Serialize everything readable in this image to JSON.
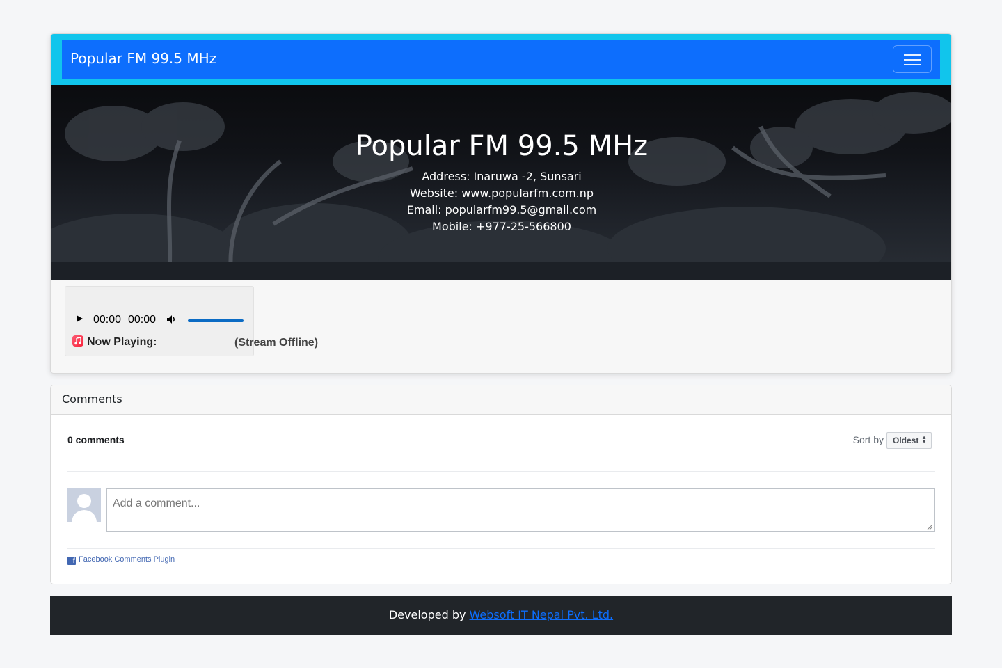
{
  "navbar": {
    "brand": "Popular FM 99.5 MHz",
    "toggler_icon": "hamburger-icon"
  },
  "hero": {
    "title": "Popular FM 99.5 MHz",
    "address": "Address: Inaruwa -2, Sunsari",
    "website": "Website: www.popularfm.com.np",
    "email": "Email: popularfm99.5@gmail.com",
    "mobile": "Mobile: +977-25-566800"
  },
  "player": {
    "current_time": "00:00",
    "duration": "00:00",
    "volume_level": 1.0,
    "now_playing_label": "Now Playing:",
    "status": "(Stream Offline)",
    "accent_color": "#0b6bc4"
  },
  "comments": {
    "header": "Comments",
    "count_label": "0 comments",
    "sort_label": "Sort by",
    "sort_value": "Oldest",
    "input_placeholder": "Add a comment...",
    "plugin_label": "Facebook Comments Plugin"
  },
  "footer": {
    "prefix": "Developed by",
    "link_text": "Websoft IT Nepal Pvt. Ltd."
  },
  "colors": {
    "navbar_outer": "#11c5ec",
    "navbar": "#0d6efd",
    "footer": "#212529",
    "facebook": "#4267b2"
  }
}
